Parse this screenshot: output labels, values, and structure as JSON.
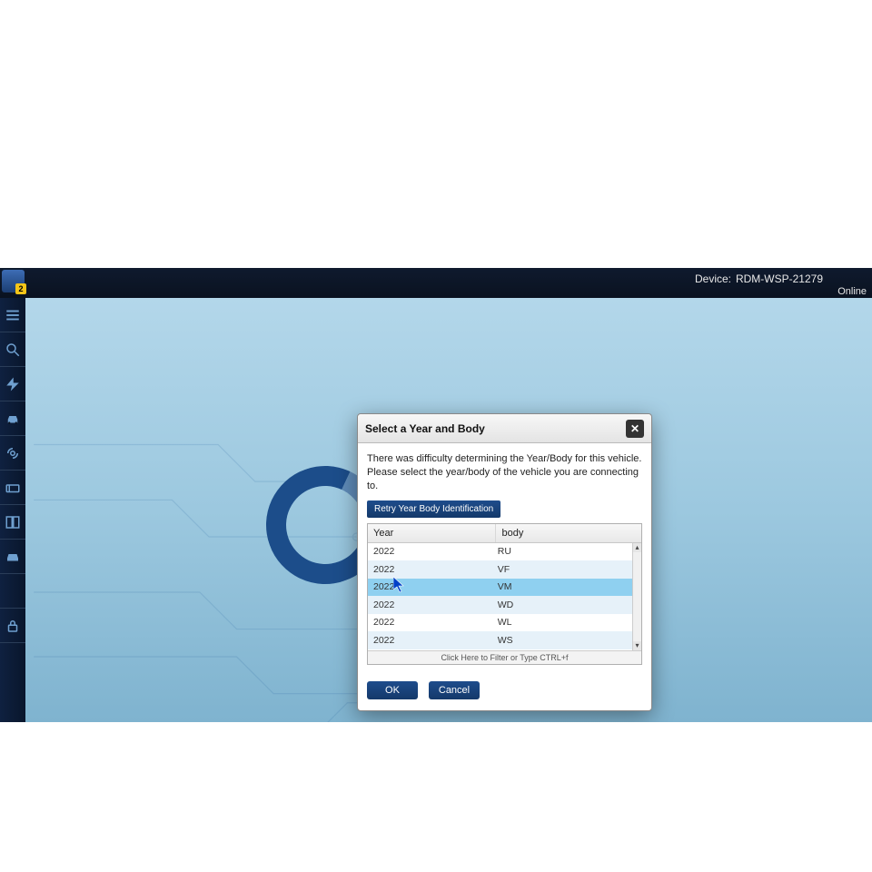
{
  "header": {
    "device_label": "Device:",
    "device_value": "RDM-WSP-21279",
    "status": "Online",
    "app_badge": "2"
  },
  "sidebar": {
    "items": [
      {
        "name": "menu-icon"
      },
      {
        "name": "search-car-icon"
      },
      {
        "name": "flash-icon"
      },
      {
        "name": "car-icon"
      },
      {
        "name": "signal-icon"
      },
      {
        "name": "meter-icon"
      },
      {
        "name": "layout-icon"
      },
      {
        "name": "vehicle-alt-icon"
      },
      {
        "name": "blank-icon"
      },
      {
        "name": "lock-icon"
      }
    ]
  },
  "dialog": {
    "title": "Select a Year and Body",
    "message": "There was difficulty determining the Year/Body for this vehicle. Please select the year/body of the vehicle you are connecting to.",
    "retry_label": "Retry Year Body Identification",
    "columns": {
      "year": "Year",
      "body": "body"
    },
    "rows": [
      {
        "year": "2022",
        "body": "RU"
      },
      {
        "year": "2022",
        "body": "VF"
      },
      {
        "year": "2022",
        "body": "VM"
      },
      {
        "year": "2022",
        "body": "WD"
      },
      {
        "year": "2022",
        "body": "WL"
      },
      {
        "year": "2022",
        "body": "WS"
      }
    ],
    "selected_index": 2,
    "filter_hint": "Click Here to Filter or Type CTRL+f",
    "ok_label": "OK",
    "cancel_label": "Cancel"
  }
}
